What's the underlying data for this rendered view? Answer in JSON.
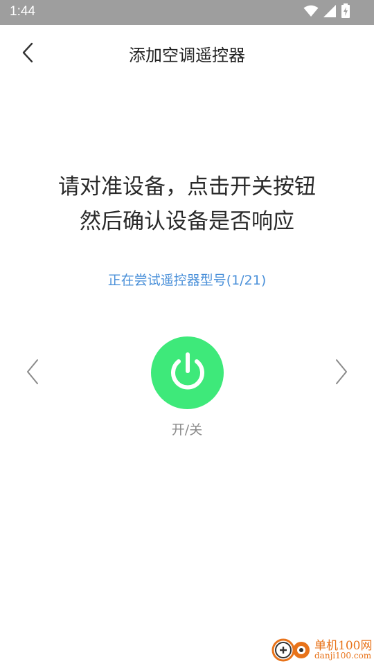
{
  "status_bar": {
    "time": "1:44",
    "icons": [
      "wifi-icon",
      "signal-icon",
      "battery-charging-icon"
    ]
  },
  "header": {
    "title": "添加空调遥控器",
    "back_icon": "chevron-left-icon"
  },
  "instruction": {
    "line1": "请对准设备，点击开关按钮",
    "line2": "然后确认设备是否响应"
  },
  "model_status": "正在尝试遥控器型号(1/21)",
  "controls": {
    "prev_icon": "chevron-left-icon",
    "next_icon": "chevron-right-icon",
    "power_icon": "power-icon",
    "power_label": "开/关"
  },
  "watermark": {
    "name": "单机100网",
    "domain": "danji100.com"
  },
  "colors": {
    "status_bar_bg": "#9e9e9e",
    "accent_blue": "#4a90d9",
    "power_green": "#3ee97a",
    "watermark_orange": "#e8731a"
  }
}
